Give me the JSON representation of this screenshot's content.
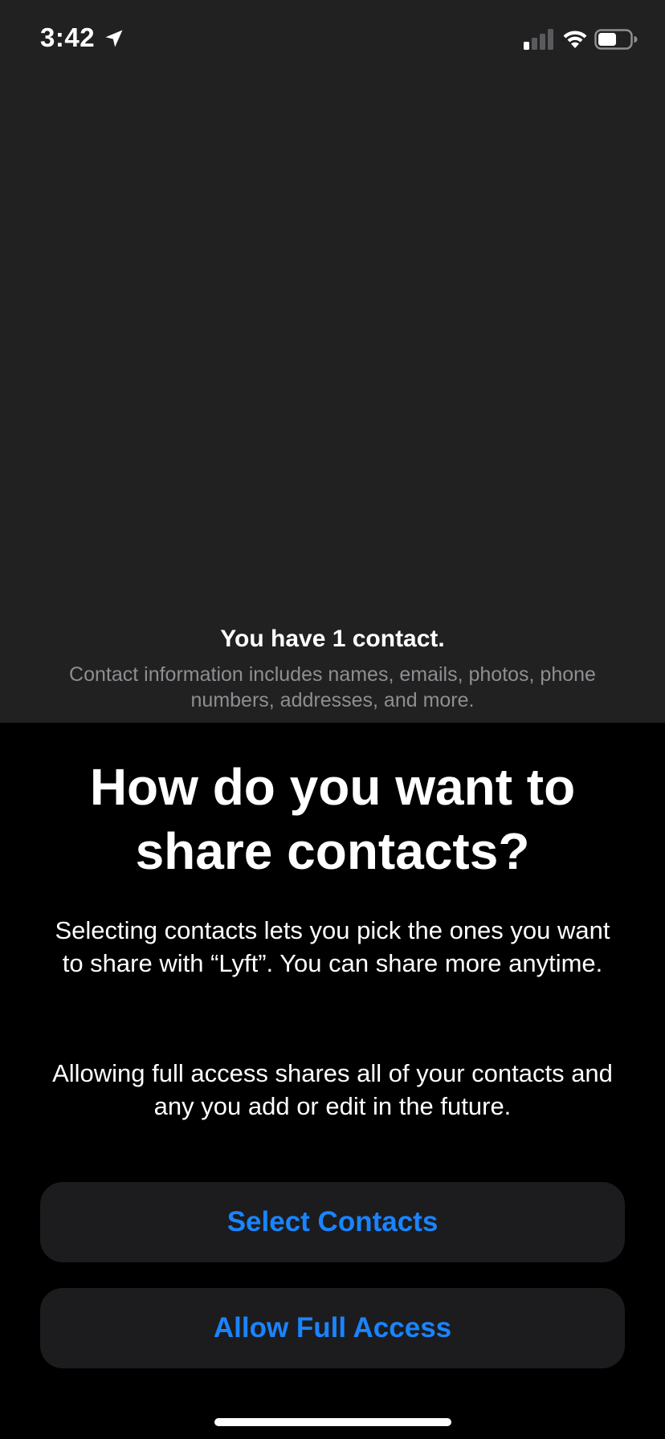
{
  "status_bar": {
    "time": "3:42",
    "location_icon": "location-arrow-icon",
    "signal_icon": "cellular-signal-icon",
    "wifi_icon": "wifi-icon",
    "battery_icon": "battery-icon"
  },
  "contact_summary": {
    "count_text": "You have 1 contact.",
    "info_text": "Contact information includes names, emails, photos, phone numbers, addresses, and more."
  },
  "sheet": {
    "title": "How do you want to share contacts?",
    "body_select": "Selecting contacts lets you pick the ones you want to share with “Lyft”. You can share more anytime.",
    "body_full": "Allowing full access shares all of your contacts and any you add or edit in the future.",
    "select_button_label": "Select Contacts",
    "full_access_button_label": "Allow Full Access"
  },
  "colors": {
    "accent": "#1a84ff",
    "top_background": "#212121",
    "sheet_background": "#000000",
    "button_background": "#1c1c1e",
    "secondary_text": "#8e8e93"
  }
}
